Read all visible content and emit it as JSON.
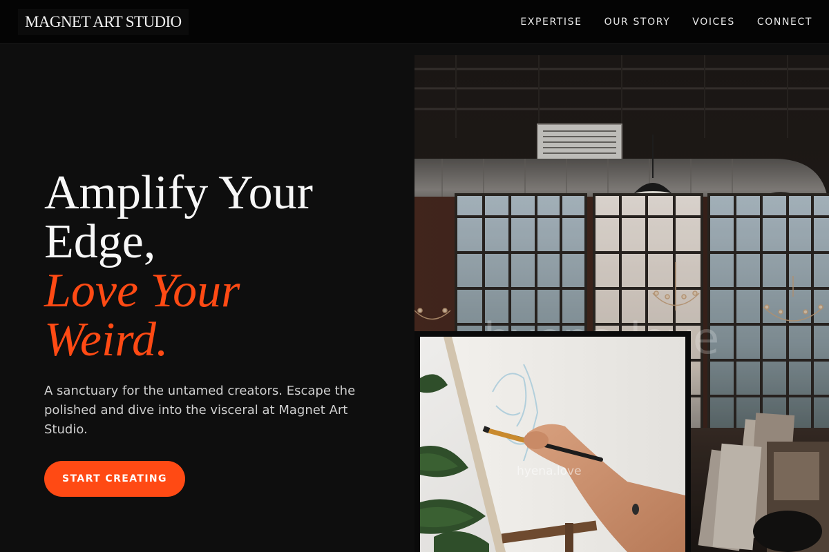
{
  "header": {
    "logo": "MAGNET ART STUDIO",
    "nav": [
      {
        "label": "EXPERTISE"
      },
      {
        "label": "OUR STORY"
      },
      {
        "label": "VOICES"
      },
      {
        "label": "CONNECT"
      }
    ]
  },
  "hero": {
    "title_line1": "Amplify Your",
    "title_line2": "Edge,",
    "accent_line1": "Love Your",
    "accent_line2": "Weird.",
    "subtitle": "A sanctuary for the untamed creators. Escape the polished and dive into the visceral at Magnet Art Studio.",
    "cta_label": "START CREATING"
  },
  "images": {
    "studio_watermark": "hyena.love",
    "painting_watermark": "hyena.love"
  },
  "colors": {
    "accent": "#ff4a14",
    "background": "#0e0e0e",
    "header": "#040404"
  }
}
